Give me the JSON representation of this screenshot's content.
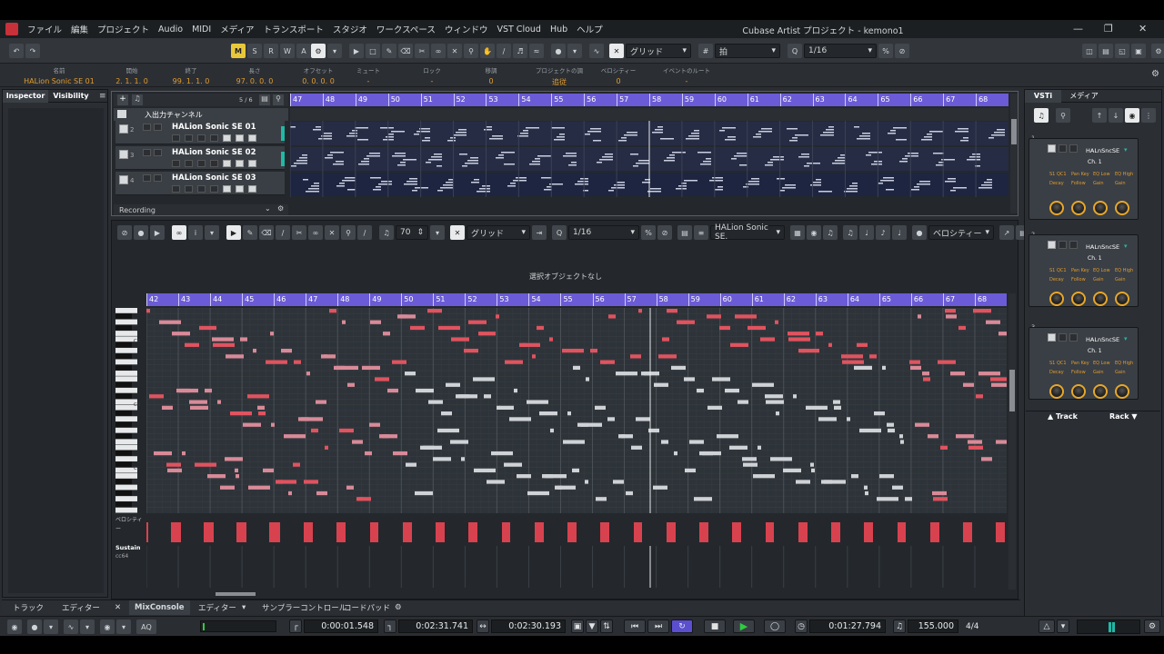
{
  "menu": {
    "items": [
      "ファイル",
      "編集",
      "プロジェクト",
      "Audio",
      "MIDI",
      "メディア",
      "トランスポート",
      "スタジオ",
      "ワークスペース",
      "ウィンドウ",
      "VST Cloud",
      "Hub",
      "ヘルプ"
    ],
    "title": "Cubase Artist プロジェクト - kemono1"
  },
  "toolbar": {
    "modes": [
      "M",
      "S",
      "R",
      "W",
      "A"
    ],
    "snap_type": "グリッド",
    "grid_label": "拍",
    "quantize": "1/16"
  },
  "infoline": {
    "fields": [
      {
        "h": "名前",
        "v": "HALion Sonic SE 01"
      },
      {
        "h": "開始",
        "v": "2. 1. 1.   0"
      },
      {
        "h": "終了",
        "v": "99. 1. 1.   0"
      },
      {
        "h": "長さ",
        "v": "97. 0. 0.   0"
      },
      {
        "h": "オフセット",
        "v": "0. 0. 0.   0"
      },
      {
        "h": "ミュート",
        "v": "-"
      },
      {
        "h": "ロック",
        "v": "-"
      },
      {
        "h": "移調",
        "v": "0"
      },
      {
        "h": "プロジェクトの調",
        "v": "追従"
      },
      {
        "h": "ベロシティー",
        "v": "0"
      },
      {
        "h": "イベントのルート",
        "v": "-"
      }
    ]
  },
  "left_tabs": [
    "Inspector",
    "Visibility"
  ],
  "project": {
    "track_count": "5 / 6",
    "folder_label": "入出力チャンネル",
    "tracks": [
      {
        "num": "2",
        "name": "HALion Sonic SE 01"
      },
      {
        "num": "3",
        "name": "HALion Sonic SE 02"
      },
      {
        "num": "4",
        "name": "HALion Sonic SE 03"
      }
    ],
    "footer": "Recording",
    "bars": [
      "47",
      "48",
      "49",
      "50",
      "51",
      "52",
      "53",
      "54",
      "55",
      "56",
      "57",
      "58",
      "59",
      "60",
      "61",
      "62",
      "63",
      "64",
      "65",
      "66",
      "67",
      "68"
    ]
  },
  "editor": {
    "velocity_value": "70",
    "snap_type": "グリッド",
    "quantize": "1/16",
    "instrument": "HALion Sonic SE.",
    "controller": "ベロシティー",
    "status": "選択オブジェクトなし",
    "bars": [
      "42",
      "43",
      "44",
      "45",
      "46",
      "47",
      "48",
      "49",
      "50",
      "51",
      "52",
      "53",
      "54",
      "55",
      "56",
      "57",
      "58",
      "59",
      "60",
      "61",
      "62",
      "63",
      "64",
      "65",
      "66",
      "67",
      "68"
    ],
    "key_labels": [
      "C4",
      "C3",
      "C2"
    ],
    "lane_velocity": "ベロシティー",
    "lane_sustain": "Sustain",
    "lane_cc": "cc64"
  },
  "bottom_tabs": [
    "トラック",
    "エディター",
    "MixConsole",
    "エディター",
    "サンプラーコントロール",
    "コードパッド"
  ],
  "rack": {
    "tabs": [
      "VSTi",
      "メディア"
    ],
    "instruments": [
      {
        "slot": "1",
        "name": "HALnSncSE",
        "ch": "Ch. 1"
      },
      {
        "slot": "2",
        "name": "HALnSncSE",
        "ch": "Ch. 1"
      },
      {
        "slot": "3",
        "name": "HALnSncSE",
        "ch": "Ch. 1"
      }
    ],
    "labels_row1": [
      "S1 QC1",
      "Pan Key",
      "EQ Low",
      "EQ High"
    ],
    "labels_row2": [
      "Decay",
      "Follow",
      "Gain",
      "Gain"
    ],
    "footer_left": "Track",
    "footer_right": "Rack"
  },
  "transport": {
    "left_locator": "0:00:01.548",
    "right_locator": "0:02:31.741",
    "length": "0:02:30.193",
    "position": "0:01:27.794",
    "tempo": "155.000",
    "signature": "4/4",
    "aq": "AQ"
  },
  "colors": {
    "ruler": "#6b5bd6",
    "note_red": "#e0535f",
    "note_pink": "#d98a98",
    "accent": "#e29b2d",
    "play": "#2ecc40"
  }
}
